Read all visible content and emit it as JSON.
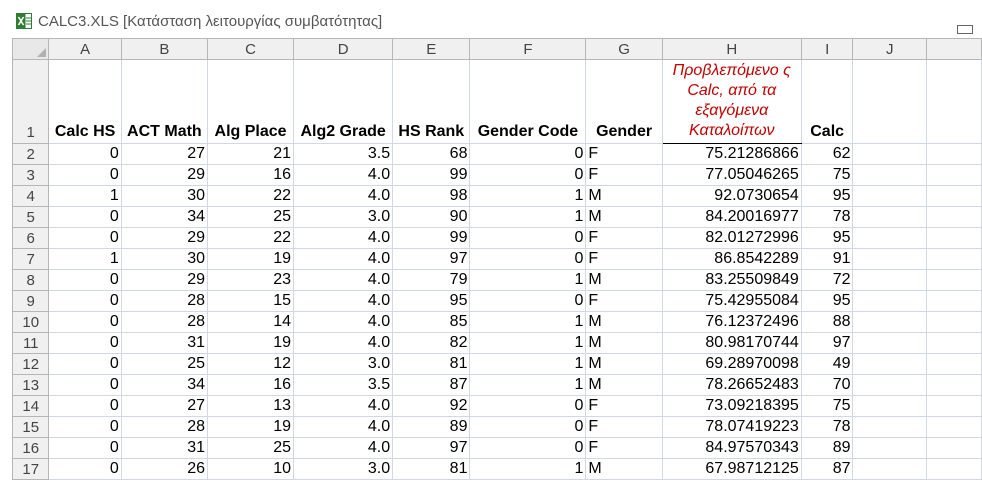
{
  "window": {
    "title": "CALC3.XLS  [Κατάσταση λειτουργίας συμβατότητας]"
  },
  "columns": [
    "A",
    "B",
    "C",
    "D",
    "E",
    "F",
    "G",
    "H",
    "I",
    "J"
  ],
  "header_row": {
    "row_number": "1",
    "cells": [
      "Calc HS",
      "ACT Math",
      "Alg Place",
      "Alg2 Grade",
      "HS Rank",
      "Gender Code",
      "Gender",
      "Προβλεπόμενο ς Calc, από τα εξαγόμενα Καταλοίπων",
      "Calc",
      ""
    ]
  },
  "rows": [
    {
      "n": "2",
      "cells": [
        "0",
        "27",
        "21",
        "3.5",
        "68",
        "0",
        "F",
        "75.21286866",
        "62",
        ""
      ]
    },
    {
      "n": "3",
      "cells": [
        "0",
        "29",
        "16",
        "4.0",
        "99",
        "0",
        "F",
        "77.05046265",
        "75",
        ""
      ]
    },
    {
      "n": "4",
      "cells": [
        "1",
        "30",
        "22",
        "4.0",
        "98",
        "1",
        "M",
        "92.0730654",
        "95",
        ""
      ]
    },
    {
      "n": "5",
      "cells": [
        "0",
        "34",
        "25",
        "3.0",
        "90",
        "1",
        "M",
        "84.20016977",
        "78",
        ""
      ]
    },
    {
      "n": "6",
      "cells": [
        "0",
        "29",
        "22",
        "4.0",
        "99",
        "0",
        "F",
        "82.01272996",
        "95",
        ""
      ]
    },
    {
      "n": "7",
      "cells": [
        "1",
        "30",
        "19",
        "4.0",
        "97",
        "0",
        "F",
        "86.8542289",
        "91",
        ""
      ]
    },
    {
      "n": "8",
      "cells": [
        "0",
        "29",
        "23",
        "4.0",
        "79",
        "1",
        "M",
        "83.25509849",
        "72",
        ""
      ]
    },
    {
      "n": "9",
      "cells": [
        "0",
        "28",
        "15",
        "4.0",
        "95",
        "0",
        "F",
        "75.42955084",
        "95",
        ""
      ]
    },
    {
      "n": "10",
      "cells": [
        "0",
        "28",
        "14",
        "4.0",
        "85",
        "1",
        "M",
        "76.12372496",
        "88",
        ""
      ]
    },
    {
      "n": "11",
      "cells": [
        "0",
        "31",
        "19",
        "4.0",
        "82",
        "1",
        "M",
        "80.98170744",
        "97",
        ""
      ]
    },
    {
      "n": "12",
      "cells": [
        "0",
        "25",
        "12",
        "3.0",
        "81",
        "1",
        "M",
        "69.28970098",
        "49",
        ""
      ]
    },
    {
      "n": "13",
      "cells": [
        "0",
        "34",
        "16",
        "3.5",
        "87",
        "1",
        "M",
        "78.26652483",
        "70",
        ""
      ]
    },
    {
      "n": "14",
      "cells": [
        "0",
        "27",
        "13",
        "4.0",
        "92",
        "0",
        "F",
        "73.09218395",
        "75",
        ""
      ]
    },
    {
      "n": "15",
      "cells": [
        "0",
        "28",
        "19",
        "4.0",
        "89",
        "0",
        "F",
        "78.07419223",
        "78",
        ""
      ]
    },
    {
      "n": "16",
      "cells": [
        "0",
        "31",
        "25",
        "4.0",
        "97",
        "0",
        "F",
        "84.97570343",
        "89",
        ""
      ]
    },
    {
      "n": "17",
      "cells": [
        "0",
        "26",
        "10",
        "3.0",
        "81",
        "1",
        "M",
        "67.98712125",
        "87",
        ""
      ]
    }
  ],
  "colors": {
    "header_red": "#c00000",
    "grid_line": "#d0d7e5",
    "heading_bg": "#f0f0f0"
  }
}
